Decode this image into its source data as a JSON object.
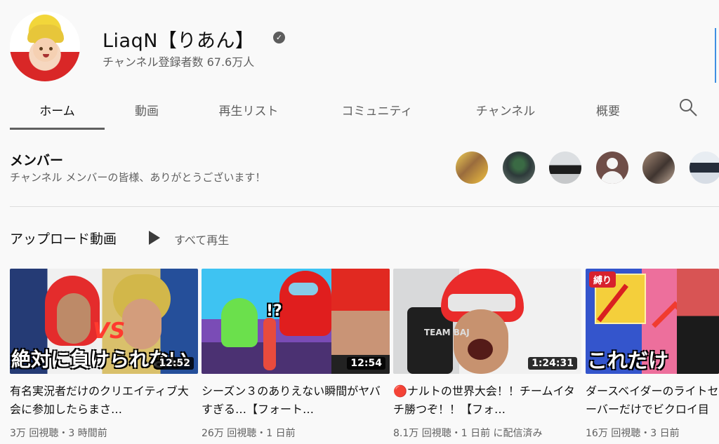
{
  "channel": {
    "name": "LiaqN【りあん】",
    "verified_icon": "verified-check-icon",
    "subscribers": "チャンネル登録者数 67.6万人"
  },
  "tabs": [
    "ホーム",
    "動画",
    "再生リスト",
    "コミュニティ",
    "チャンネル",
    "概要"
  ],
  "members": {
    "title": "メンバー",
    "subtitle": "チャンネル メンバーの皆様、ありがとうございます！"
  },
  "uploads": {
    "title": "アップロード動画",
    "play_all": "すべて再生"
  },
  "videos": [
    {
      "title": "有名実況者だけのクリエイティブ大会に参加したらまさ…",
      "duration": "12:52",
      "meta": "3万 回視聴・3 時間前",
      "thumb_text": "絶対に負けられない"
    },
    {
      "title": "シーズン３のありえない瞬間がヤバすぎる…【フォート…",
      "duration": "12:54",
      "meta": "26万 回視聴・1 日前",
      "thumb_text": "!?"
    },
    {
      "title": "🔴ナルトの世界大会！！チームイタチ勝つぞ！！【フォ…",
      "duration": "1:24:31",
      "meta": "8.1万 回視聴・1 日前 に配信済み",
      "thumb_text": "TEAM BAJ"
    },
    {
      "title": "ダースベイダーのライトセーバーだけでビクロイ目指…",
      "duration": "",
      "meta": "16万 回視聴・3 日前",
      "thumb_text": "これだけ",
      "badge": "縛り"
    }
  ]
}
